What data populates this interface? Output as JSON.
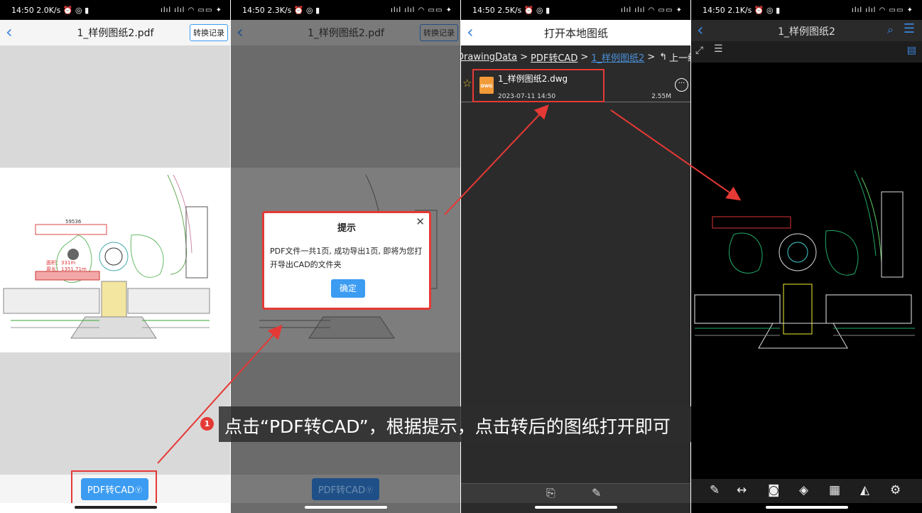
{
  "status_bars": [
    {
      "time": "14:50",
      "speed": "2.0K/s",
      "icons": "⏰ ◎ ▮",
      "right": "ılıl ılıl ◠ ▭▭ ✦"
    },
    {
      "time": "14:50",
      "speed": "2.3K/s",
      "icons": "⏰ ◎ ▮",
      "right": "ılıl ılıl ◠ ▭▭ ✦"
    },
    {
      "time": "14:50",
      "speed": "2.5K/s",
      "icons": "⏰ ◎ ▮",
      "right": "ılıl ılıl ◠ ▭▭ ✦"
    },
    {
      "time": "14:50",
      "speed": "2.1K/s",
      "icons": "⏰ ◎ ▮",
      "right": "ılıl ılıl ◠ ▭▭ ✦"
    }
  ],
  "screen1": {
    "title": "1_样例图纸2.pdf",
    "history_button": "转换记录",
    "pdf_to_cad_button": "PDF转CAD",
    "drawing_labels": {
      "dim": "59536",
      "area": "面积：331m",
      "perimeter": "周长：1351.71m"
    }
  },
  "screen2": {
    "title": "1_样例图纸2.pdf",
    "history_button": "转换记录",
    "pdf_to_cad_button": "PDF转CAD",
    "dialog": {
      "title": "提示",
      "message": "PDF文件一共1页, 成功导出1页, 即将为您打开导出CAD的文件夹",
      "ok": "确定"
    }
  },
  "screen3": {
    "title": "打开本地图纸",
    "breadcrumb": [
      "DrawingData",
      "PDF转CAD",
      "1_样例图纸2"
    ],
    "separator": ">",
    "up_level": "上一级",
    "file": {
      "name": "1_样例图纸2.dwg",
      "date": "2023-07-11 14:50",
      "size": "2.55M",
      "badge": "DWG"
    }
  },
  "screen4": {
    "title": "1_样例图纸2",
    "toolbar": [
      "edit",
      "measure",
      "camera",
      "layers",
      "layout",
      "draw-area",
      "settings"
    ]
  },
  "caption": {
    "step": "1",
    "text": "点击“PDF转CAD”，根据提示，点击转后的图纸打开即可"
  },
  "colors": {
    "accent": "#3b9cf2",
    "annotation_red": "#e53935",
    "dark_bg": "#2b2b2b",
    "viewer_bg": "#000000"
  }
}
